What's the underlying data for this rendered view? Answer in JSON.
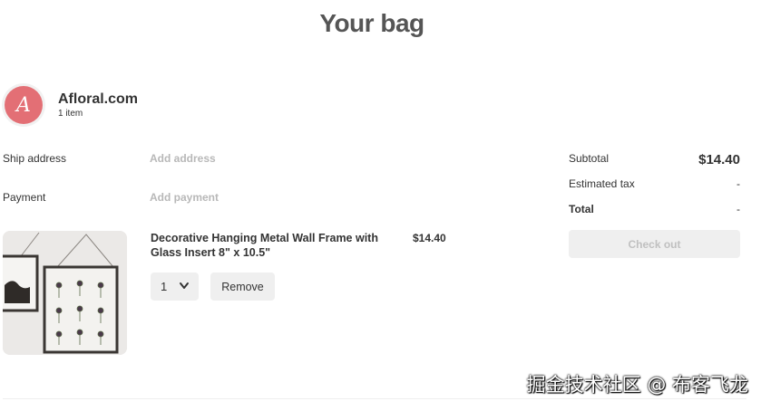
{
  "page": {
    "title": "Your bag"
  },
  "merchant": {
    "name": "Afloral.com",
    "item_count": "1 item",
    "avatar_letter": "A",
    "avatar_color": "#e36f75"
  },
  "shipping": {
    "label": "Ship address",
    "action": "Add address"
  },
  "payment": {
    "label": "Payment",
    "action": "Add payment"
  },
  "product": {
    "name": "Decorative Hanging Metal Wall Frame with Glass Insert 8\" x 10.5\"",
    "price": "$14.40",
    "quantity": "1",
    "remove_label": "Remove",
    "image_icon": "framed-pressed-flowers-image"
  },
  "summary": {
    "subtotal_label": "Subtotal",
    "subtotal_value": "$14.40",
    "tax_label": "Estimated tax",
    "tax_value": "-",
    "total_label": "Total",
    "total_value": "-",
    "checkout_label": "Check out"
  },
  "watermark": "掘金技术社区 @ 布客飞龙",
  "colors": {
    "accent": "#e36f75",
    "button_bg": "#efefef",
    "muted_text": "#b8b8b8"
  }
}
